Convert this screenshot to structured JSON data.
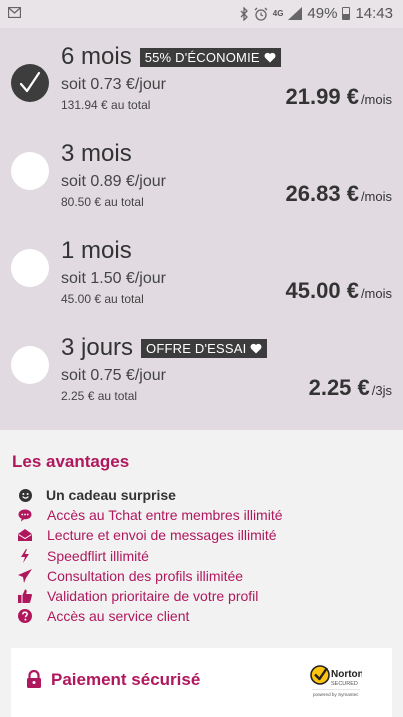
{
  "status_bar": {
    "network": "4G",
    "battery": "49%",
    "time": "14:43"
  },
  "plans": [
    {
      "duration": "6 mois",
      "badge": "55% D'ÉCONOMIE",
      "daily": "soit 0.73 €/jour",
      "total": "131.94 € au total",
      "price": "21.99 €",
      "period": "/mois",
      "selected": true
    },
    {
      "duration": "3 mois",
      "badge": "",
      "daily": "soit 0.89 €/jour",
      "total": "80.50 € au total",
      "price": "26.83 €",
      "period": "/mois",
      "selected": false
    },
    {
      "duration": "1 mois",
      "badge": "",
      "daily": "soit 1.50 €/jour",
      "total": "45.00 € au total",
      "price": "45.00 €",
      "period": "/mois",
      "selected": false
    },
    {
      "duration": "3 jours",
      "badge": "OFFRE D'ESSAI",
      "daily": "soit 0.75 €/jour",
      "total": "2.25 € au total",
      "price": "2.25 €",
      "period": "/3js",
      "selected": false
    }
  ],
  "advantages": {
    "title": "Les avantages",
    "items": [
      {
        "icon": "smiley-icon",
        "label": "Un cadeau surprise"
      },
      {
        "icon": "chat-bubble-icon",
        "label": "Accès au Tchat entre membres illimité"
      },
      {
        "icon": "envelope-icon",
        "label": "Lecture et envoi de messages illimité"
      },
      {
        "icon": "lightning-icon",
        "label": "Speedflirt illimité"
      },
      {
        "icon": "paper-plane-icon",
        "label": "Consultation des profils illimitée"
      },
      {
        "icon": "thumbs-up-icon",
        "label": "Validation prioritaire de votre profil"
      },
      {
        "icon": "question-circle-icon",
        "label": "Accès au service client"
      }
    ]
  },
  "secure_payment": {
    "label": "Paiement sécurisé",
    "seal_name": "Norton",
    "seal_text": "SECURED",
    "seal_powered": "powered by Symantec"
  },
  "colors": {
    "accent": "#b0185e",
    "panel": "#e1dbe1",
    "badge_bg": "#3c3c3c",
    "checked_radio": "#3d3d3d"
  }
}
